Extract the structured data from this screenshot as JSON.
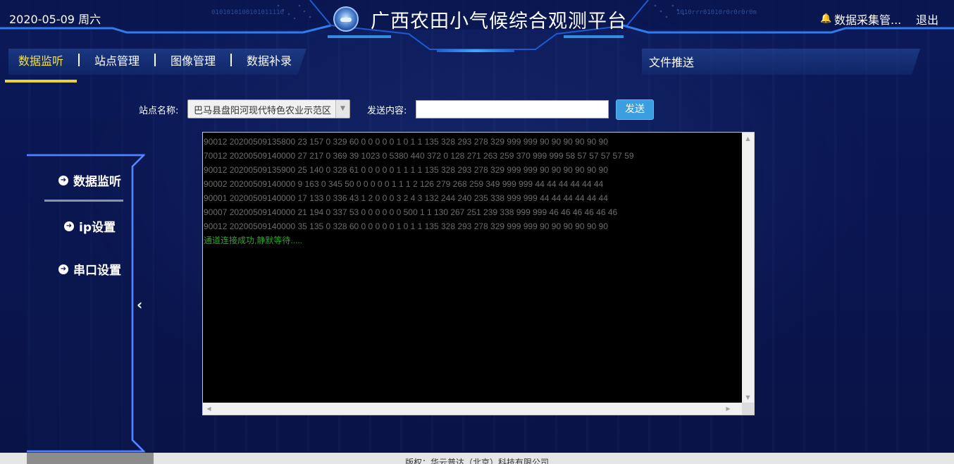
{
  "header": {
    "date": "2020-05-09 周六",
    "title": "广西农田小气候综合观测平台",
    "user_label": "数据采集管...",
    "logout_label": "退出"
  },
  "nav": {
    "items": [
      {
        "label": "数据监听",
        "active": true
      },
      {
        "label": "站点管理",
        "active": false
      },
      {
        "label": "图像管理",
        "active": false
      },
      {
        "label": "数据补录",
        "active": false
      }
    ],
    "right_label": "文件推送"
  },
  "form": {
    "station_label": "站点名称:",
    "station_value": "巴马县盘阳河现代特色农业示范区",
    "content_label": "发送内容:",
    "content_value": "",
    "send_label": "发送"
  },
  "sidebar": {
    "items": [
      {
        "label": "数据监听"
      },
      {
        "label": "ip设置"
      },
      {
        "label": "串口设置"
      }
    ]
  },
  "console": {
    "lines": [
      "90012 20200509135800 23 157 0 329 60 0 0 0 0 0 1 0 1 1 135 328 293 278 329 999 999 90 90 90 90 90 90",
      "70012 20200509140000 27 217 0 369 39 1023 0 5380 440 372 0 128 271 263 259 370 999 999 58 57 57 57 57 59",
      "90012 20200509135900 25 140 0 328 61 0 0 0 0 0 1 1 1 1 135 328 293 278 329 999 999 90 90 90 90 90 90",
      "90002 20200509140000 9 163 0 345 50 0 0 0 0 0 1 1 1 2 126 279 268 259 349 999 999 44 44 44 44 44 44",
      "90001 20200509140000 17 133 0 336 43 1 2 0 0 0 3 2 4 3 132 244 240 235 338 999 999 44 44 44 44 44 44",
      "90007 20200509140000 21 194 0 337 53 0 0 0 0 0 0 500 1 1 130 267 251 239 338 999 999 46 46 46 46 46 46",
      "90012 20200509140000 35 135 0 328 60 0 0 0 0 0 1 0 1 1 135 328 293 278 329 999 999 90 90 90 90 90 90"
    ],
    "status": "通道连接成功,静默等待....."
  },
  "footer": {
    "copyright": "版权：华云普达（北京）科技有限公司"
  },
  "colors": {
    "accent": "#e8d532",
    "button": "#3a9ee0",
    "status_ok": "#2fa52f"
  }
}
